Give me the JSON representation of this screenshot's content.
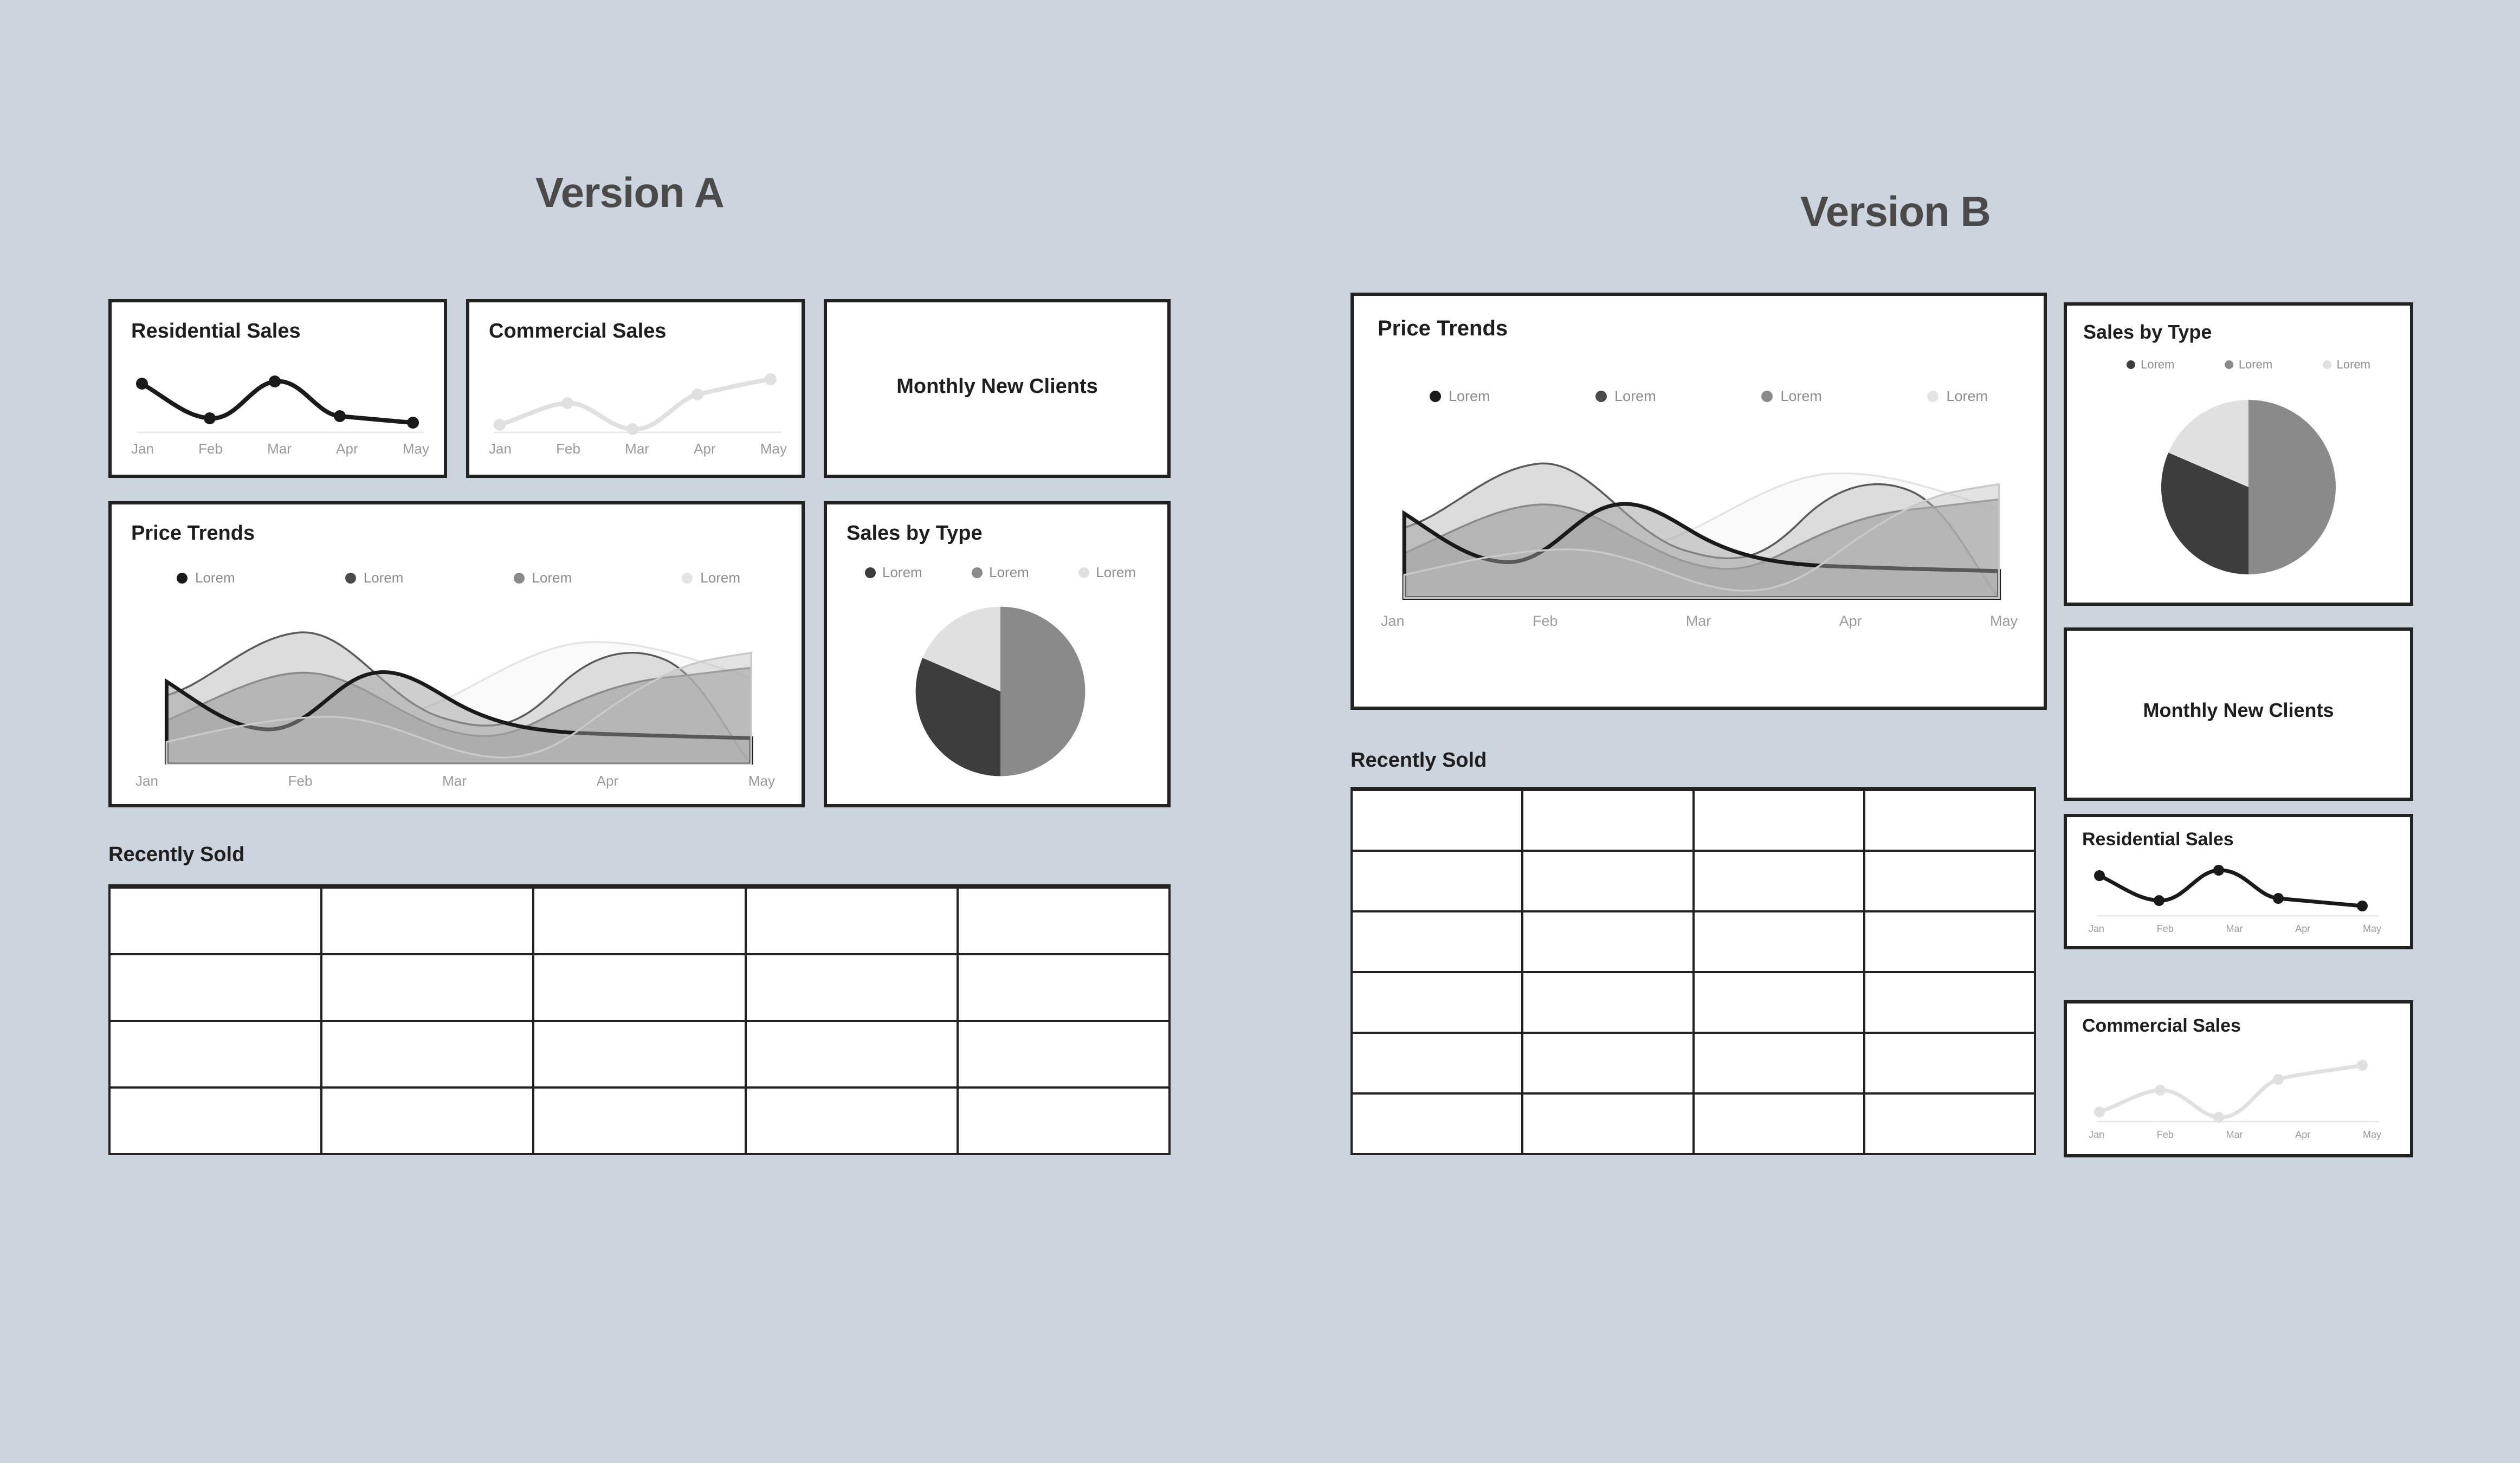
{
  "background_color": "#ccd5de",
  "versions": [
    {
      "id": "a",
      "title": "Version A"
    },
    {
      "id": "b",
      "title": "Version B"
    }
  ],
  "palette": {
    "series_1": "#1a1a1a",
    "series_2": "#4a4a4a",
    "series_3": "#8a8a8a",
    "series_4": "#e4e4e4",
    "card_border": "#222222",
    "card_background": "#ffffff",
    "table_header_fill": "#e3e3e3",
    "axis_label": "#9a9a9a",
    "legend_label": "#8c8c8c",
    "title_text": "#1e1e1e",
    "version_title_text": "#4a4a4a"
  },
  "version_a": {
    "residential_sales": {
      "title": "Residential Sales"
    },
    "commercial_sales": {
      "title": "Commercial Sales"
    },
    "monthly_new_clients": {
      "title": "Monthly New Clients"
    },
    "price_trends": {
      "title": "Price Trends"
    },
    "sales_by_type": {
      "title": "Sales by Type"
    },
    "recently_sold": {
      "title": "Recently Sold"
    }
  },
  "version_b": {
    "price_trends": {
      "title": "Price Trends"
    },
    "recently_sold": {
      "title": "Recently Sold"
    },
    "sales_by_type": {
      "title": "Sales by Type"
    },
    "monthly_new_clients": {
      "title": "Monthly New Clients"
    },
    "residential_sales": {
      "title": "Residential Sales"
    },
    "commercial_sales": {
      "title": "Commercial Sales"
    }
  },
  "legends": {
    "price_trends": [
      {
        "label": "Lorem",
        "color": "#1a1a1a"
      },
      {
        "label": "Lorem",
        "color": "#4a4a4a"
      },
      {
        "label": "Lorem",
        "color": "#8a8a8a"
      },
      {
        "label": "Lorem",
        "color": "#e4e4e4"
      }
    ],
    "sales_by_type": [
      {
        "label": "Lorem",
        "color": "#3d3d3d"
      },
      {
        "label": "Lorem",
        "color": "#8a8a8a"
      },
      {
        "label": "Lorem",
        "color": "#e0e0e0"
      }
    ]
  },
  "axis_months": [
    "Jan",
    "Feb",
    "Mar",
    "Apr",
    "May"
  ],
  "chart_data": [
    {
      "id": "residential-sales",
      "type": "line",
      "title": "Residential Sales",
      "xlabel": "",
      "ylabel": "",
      "categories": [
        "Jan",
        "Feb",
        "Mar",
        "Apr",
        "May"
      ],
      "values": [
        68,
        30,
        88,
        33,
        22
      ],
      "ylim": [
        0,
        100
      ],
      "grid": false,
      "legend": "none",
      "series_color": "#1a1a1a",
      "markers": true
    },
    {
      "id": "commercial-sales",
      "type": "line",
      "title": "Commercial Sales",
      "xlabel": "",
      "ylabel": "",
      "categories": [
        "Jan",
        "Feb",
        "Mar",
        "Apr",
        "May"
      ],
      "values": [
        18,
        47,
        8,
        72,
        88
      ],
      "ylim": [
        0,
        100
      ],
      "grid": false,
      "legend": "none",
      "series_color": "#e0e0e0",
      "markers": true
    },
    {
      "id": "price-trends",
      "type": "area",
      "title": "Price Trends",
      "xlabel": "",
      "ylabel": "",
      "categories": [
        "Jan",
        "Feb",
        "Mar",
        "Apr",
        "May"
      ],
      "ylim": [
        0,
        100
      ],
      "grid": false,
      "legend": "top",
      "series": [
        {
          "name": "Lorem",
          "color": "#1a1a1a",
          "values": [
            62,
            18,
            58,
            20,
            14
          ]
        },
        {
          "name": "Lorem",
          "color": "#4a4a4a",
          "values": [
            30,
            92,
            32,
            74,
            0
          ]
        },
        {
          "name": "Lorem",
          "color": "#8a8a8a",
          "values": [
            48,
            70,
            26,
            64,
            56
          ]
        },
        {
          "name": "Lorem",
          "color": "#e4e4e4",
          "values": [
            12,
            26,
            10,
            80,
            58
          ]
        }
      ]
    },
    {
      "id": "sales-by-type",
      "type": "pie",
      "title": "Sales by Type",
      "legend": "top",
      "labels": [
        "Lorem",
        "Lorem",
        "Lorem"
      ],
      "values": [
        50,
        30,
        20
      ],
      "colors": [
        "#8a8a8a",
        "#3d3d3d",
        "#e0e0e0"
      ]
    }
  ],
  "tables": {
    "version_a": {
      "columns": 5,
      "header_rows": 1,
      "body_rows": 4,
      "header_cells": [
        "",
        "",
        "",
        "",
        ""
      ],
      "rows": [
        [
          "",
          "",
          "",
          "",
          ""
        ],
        [
          "",
          "",
          "",
          "",
          ""
        ],
        [
          "",
          "",
          "",
          "",
          ""
        ],
        [
          "",
          "",
          "",
          "",
          ""
        ]
      ]
    },
    "version_b": {
      "columns": 4,
      "header_rows": 1,
      "body_rows": 6,
      "header_cells": [
        "",
        "",
        "",
        ""
      ],
      "rows": [
        [
          "",
          "",
          "",
          ""
        ],
        [
          "",
          "",
          "",
          ""
        ],
        [
          "",
          "",
          "",
          ""
        ],
        [
          "",
          "",
          "",
          ""
        ],
        [
          "",
          "",
          "",
          ""
        ],
        [
          "",
          "",
          "",
          ""
        ]
      ]
    }
  }
}
